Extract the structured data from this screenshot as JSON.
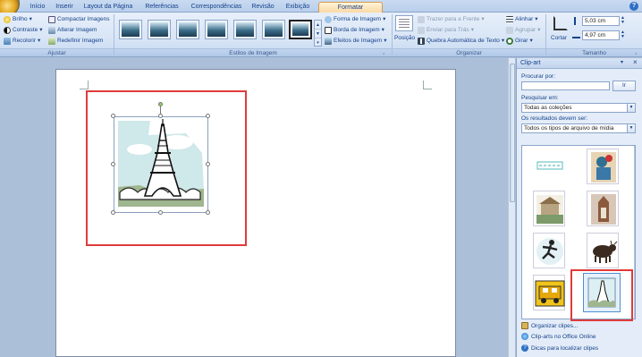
{
  "tabs": {
    "items": [
      "Início",
      "Inserir",
      "Layout da Página",
      "Referências",
      "Correspondências",
      "Revisão",
      "Exibição",
      "Formatar"
    ]
  },
  "ajustar": {
    "brilho": "Brilho",
    "contraste": "Contraste",
    "recolorir": "Recolorir",
    "compactar": "Compactar Imagens",
    "alterar": "Alterar Imagem",
    "redefinir": "Redefinir Imagem",
    "label": "Ajustar"
  },
  "estilos": {
    "forma": "Forma de Imagem",
    "borda": "Borda de Imagem",
    "efeitos": "Efeitos de Imagem",
    "label": "Estilos de Imagem"
  },
  "organizar": {
    "posicao": "Posição",
    "trazer": "Trazer para a Frente",
    "enviar": "Enviar para Trás",
    "quebra": "Quebra Automática de Texto",
    "alinhar": "Alinhar",
    "agrupar": "Agrupar",
    "girar": "Girar",
    "label": "Organizar"
  },
  "tamanho": {
    "cortar": "Cortar",
    "height": "5,03 cm",
    "width": "4,97 cm",
    "label": "Tamanho"
  },
  "pane": {
    "title": "Clip-art",
    "search_label": "Procurar por:",
    "search_value": "",
    "go_label": "Ir",
    "search_in_label": "Pesquisar em:",
    "search_in_value": "Todas as coleções",
    "results_label": "Os resultados devem ser:",
    "results_value": "Todos os tipos de arquivo de mídia",
    "link_organize": "Organizar clipes...",
    "link_online": "Clip-arts no Office Online",
    "link_tips": "Dicas para localizar clipes"
  },
  "colors": {
    "highlight_box": "#e03a3a",
    "active_tab": "#fbd8a5",
    "ribbon": "#d8e5f6"
  }
}
